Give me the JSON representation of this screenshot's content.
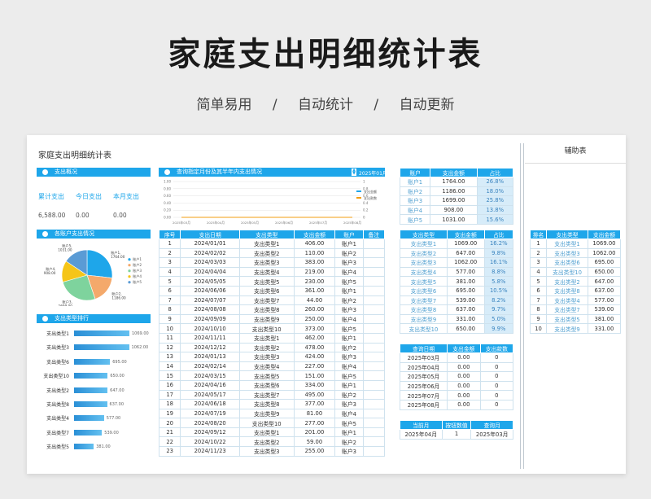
{
  "hero": {
    "title": "家庭支出明细统计表",
    "tags": [
      "简单易用",
      "/",
      "自动统计",
      "/",
      "自动更新"
    ]
  },
  "sheet": {
    "title": "家庭支出明细统计表",
    "aux_title": "辅助表",
    "overview": {
      "header": "支出概况",
      "labels": [
        "累计支出",
        "今日支出",
        "本月支出"
      ],
      "values": [
        "6,588.00",
        "0.00",
        "0.00"
      ]
    },
    "line_panel": {
      "header": "查询指定月份及其半年内支出情况",
      "month_value": "2025年01月",
      "legend": [
        "支出金额",
        "支出款数"
      ],
      "colors": [
        "#1ea6ea",
        "#f39c12"
      ]
    },
    "pie_panel": {
      "header": "各账户支出情况",
      "legend": [
        "账户1",
        "账户2",
        "账户3",
        "账户4",
        "账户5"
      ],
      "callouts": [
        "账户1,\n1764.00",
        "账户2,\n1186.00",
        "账户3,\n1699.00",
        "账户4,\n908.00",
        "账户5,\n1031.00"
      ],
      "colors": [
        "#1ea6ea",
        "#f4a96b",
        "#7ed39d",
        "#f5c518",
        "#5a9bd5"
      ]
    },
    "rank_panel": {
      "header": "支出类型排行",
      "items": [
        {
          "label": "支出类型1",
          "value": "1069.00"
        },
        {
          "label": "支出类型3",
          "value": "1062.00"
        },
        {
          "label": "支出类型6",
          "value": "695.00"
        },
        {
          "label": "支出类型10",
          "value": "650.00"
        },
        {
          "label": "支出类型2",
          "value": "647.00"
        },
        {
          "label": "支出类型8",
          "value": "637.00"
        },
        {
          "label": "支出类型4",
          "value": "577.00"
        },
        {
          "label": "支出类型7",
          "value": "539.00"
        },
        {
          "label": "支出类型5",
          "value": "381.00"
        }
      ]
    },
    "main_table": {
      "headers": [
        "序号",
        "支出日期",
        "支出类型",
        "支出金额",
        "账户",
        "备注"
      ],
      "rows": [
        [
          "1",
          "2024/01/01",
          "支出类型1",
          "406.00",
          "账户1",
          ""
        ],
        [
          "2",
          "2024/02/02",
          "支出类型2",
          "110.00",
          "账户2",
          ""
        ],
        [
          "3",
          "2024/03/03",
          "支出类型3",
          "383.00",
          "账户3",
          ""
        ],
        [
          "4",
          "2024/04/04",
          "支出类型4",
          "219.00",
          "账户4",
          ""
        ],
        [
          "5",
          "2024/05/05",
          "支出类型5",
          "230.00",
          "账户5",
          ""
        ],
        [
          "6",
          "2024/06/06",
          "支出类型6",
          "361.00",
          "账户1",
          ""
        ],
        [
          "7",
          "2024/07/07",
          "支出类型7",
          "44.00",
          "账户2",
          ""
        ],
        [
          "8",
          "2024/08/08",
          "支出类型8",
          "260.00",
          "账户3",
          ""
        ],
        [
          "9",
          "2024/09/09",
          "支出类型9",
          "250.00",
          "账户4",
          ""
        ],
        [
          "10",
          "2024/10/10",
          "支出类型10",
          "373.00",
          "账户5",
          ""
        ],
        [
          "11",
          "2024/11/11",
          "支出类型1",
          "462.00",
          "账户1",
          ""
        ],
        [
          "12",
          "2024/12/12",
          "支出类型2",
          "478.00",
          "账户2",
          ""
        ],
        [
          "13",
          "2024/01/13",
          "支出类型3",
          "424.00",
          "账户3",
          ""
        ],
        [
          "14",
          "2024/02/14",
          "支出类型4",
          "227.00",
          "账户4",
          ""
        ],
        [
          "15",
          "2024/03/15",
          "支出类型5",
          "151.00",
          "账户5",
          ""
        ],
        [
          "16",
          "2024/04/16",
          "支出类型6",
          "334.00",
          "账户1",
          ""
        ],
        [
          "17",
          "2024/05/17",
          "支出类型7",
          "495.00",
          "账户2",
          ""
        ],
        [
          "18",
          "2024/06/18",
          "支出类型8",
          "377.00",
          "账户3",
          ""
        ],
        [
          "19",
          "2024/07/19",
          "支出类型9",
          "81.00",
          "账户4",
          ""
        ],
        [
          "20",
          "2024/08/20",
          "支出类型10",
          "277.00",
          "账户5",
          ""
        ],
        [
          "21",
          "2024/09/12",
          "支出类型1",
          "201.00",
          "账户1",
          ""
        ],
        [
          "22",
          "2024/10/22",
          "支出类型2",
          "59.00",
          "账户2",
          ""
        ],
        [
          "23",
          "2024/11/23",
          "支出类型3",
          "255.00",
          "账户3",
          ""
        ]
      ]
    },
    "account_table": {
      "headers": [
        "账户",
        "支出金额",
        "占比"
      ],
      "rows": [
        [
          "账户1",
          "1764.00",
          "26.8%"
        ],
        [
          "账户2",
          "1186.00",
          "18.0%"
        ],
        [
          "账户3",
          "1699.00",
          "25.8%"
        ],
        [
          "账户4",
          "908.00",
          "13.8%"
        ],
        [
          "账户5",
          "1031.00",
          "15.6%"
        ]
      ]
    },
    "type_table": {
      "headers": [
        "支出类型",
        "支出金额",
        "占比"
      ],
      "rows": [
        [
          "支出类型1",
          "1069.00",
          "16.2%"
        ],
        [
          "支出类型2",
          "647.00",
          "9.8%"
        ],
        [
          "支出类型3",
          "1062.00",
          "16.1%"
        ],
        [
          "支出类型4",
          "577.00",
          "8.8%"
        ],
        [
          "支出类型5",
          "381.00",
          "5.8%"
        ],
        [
          "支出类型6",
          "695.00",
          "10.5%"
        ],
        [
          "支出类型7",
          "539.00",
          "8.2%"
        ],
        [
          "支出类型8",
          "637.00",
          "9.7%"
        ],
        [
          "支出类型9",
          "331.00",
          "5.0%"
        ],
        [
          "支出类型10",
          "650.00",
          "9.9%"
        ]
      ]
    },
    "query_table": {
      "headers": [
        "查询日期",
        "支出金额",
        "支出款数"
      ],
      "rows": [
        [
          "2025年03月",
          "0.00",
          "0"
        ],
        [
          "2025年04月",
          "0.00",
          "0"
        ],
        [
          "2025年05月",
          "0.00",
          "0"
        ],
        [
          "2025年06月",
          "0.00",
          "0"
        ],
        [
          "2025年07月",
          "0.00",
          "0"
        ],
        [
          "2025年08月",
          "0.00",
          "0"
        ]
      ]
    },
    "current_table": {
      "headers": [
        "当前月",
        "按钮数值",
        "查询月"
      ],
      "row": [
        "2025年04月",
        "1",
        "2025年03月"
      ]
    },
    "rank_table": {
      "headers": [
        "排名",
        "支出类型",
        "支出金额"
      ],
      "rows": [
        [
          "1",
          "支出类型1",
          "1069.00"
        ],
        [
          "2",
          "支出类型3",
          "1062.00"
        ],
        [
          "3",
          "支出类型6",
          "695.00"
        ],
        [
          "4",
          "支出类型10",
          "650.00"
        ],
        [
          "5",
          "支出类型2",
          "647.00"
        ],
        [
          "6",
          "支出类型8",
          "637.00"
        ],
        [
          "7",
          "支出类型4",
          "577.00"
        ],
        [
          "8",
          "支出类型7",
          "539.00"
        ],
        [
          "9",
          "支出类型5",
          "381.00"
        ],
        [
          "10",
          "支出类型9",
          "331.00"
        ]
      ]
    }
  },
  "chart_data": [
    {
      "type": "line",
      "x": [
        "2025年03月",
        "2025年04月",
        "2025年05月",
        "2025年06月",
        "2025年07月",
        "2025年08月"
      ],
      "series": [
        {
          "name": "支出金额",
          "values": [
            0,
            0,
            0,
            0,
            0,
            0
          ]
        },
        {
          "name": "支出款数",
          "values": [
            0,
            0,
            0,
            0,
            0,
            0
          ]
        }
      ],
      "y_ticks_left": [
        "1.00",
        "0.80",
        "0.60",
        "0.40",
        "0.20",
        "0.00"
      ],
      "y_ticks_right": [
        "1",
        "0.8",
        "0.6",
        "0.4",
        "0.2",
        "0"
      ],
      "ylim": [
        0,
        1
      ]
    },
    {
      "type": "pie",
      "labels": [
        "账户1",
        "账户2",
        "账户3",
        "账户4",
        "账户5"
      ],
      "values": [
        1764,
        1186,
        1699,
        908,
        1031
      ]
    },
    {
      "type": "bar",
      "categories": [
        "支出类型1",
        "支出类型3",
        "支出类型6",
        "支出类型10",
        "支出类型2",
        "支出类型8",
        "支出类型4",
        "支出类型7",
        "支出类型5"
      ],
      "values": [
        1069,
        1062,
        695,
        650,
        647,
        637,
        577,
        539,
        381
      ]
    }
  ]
}
